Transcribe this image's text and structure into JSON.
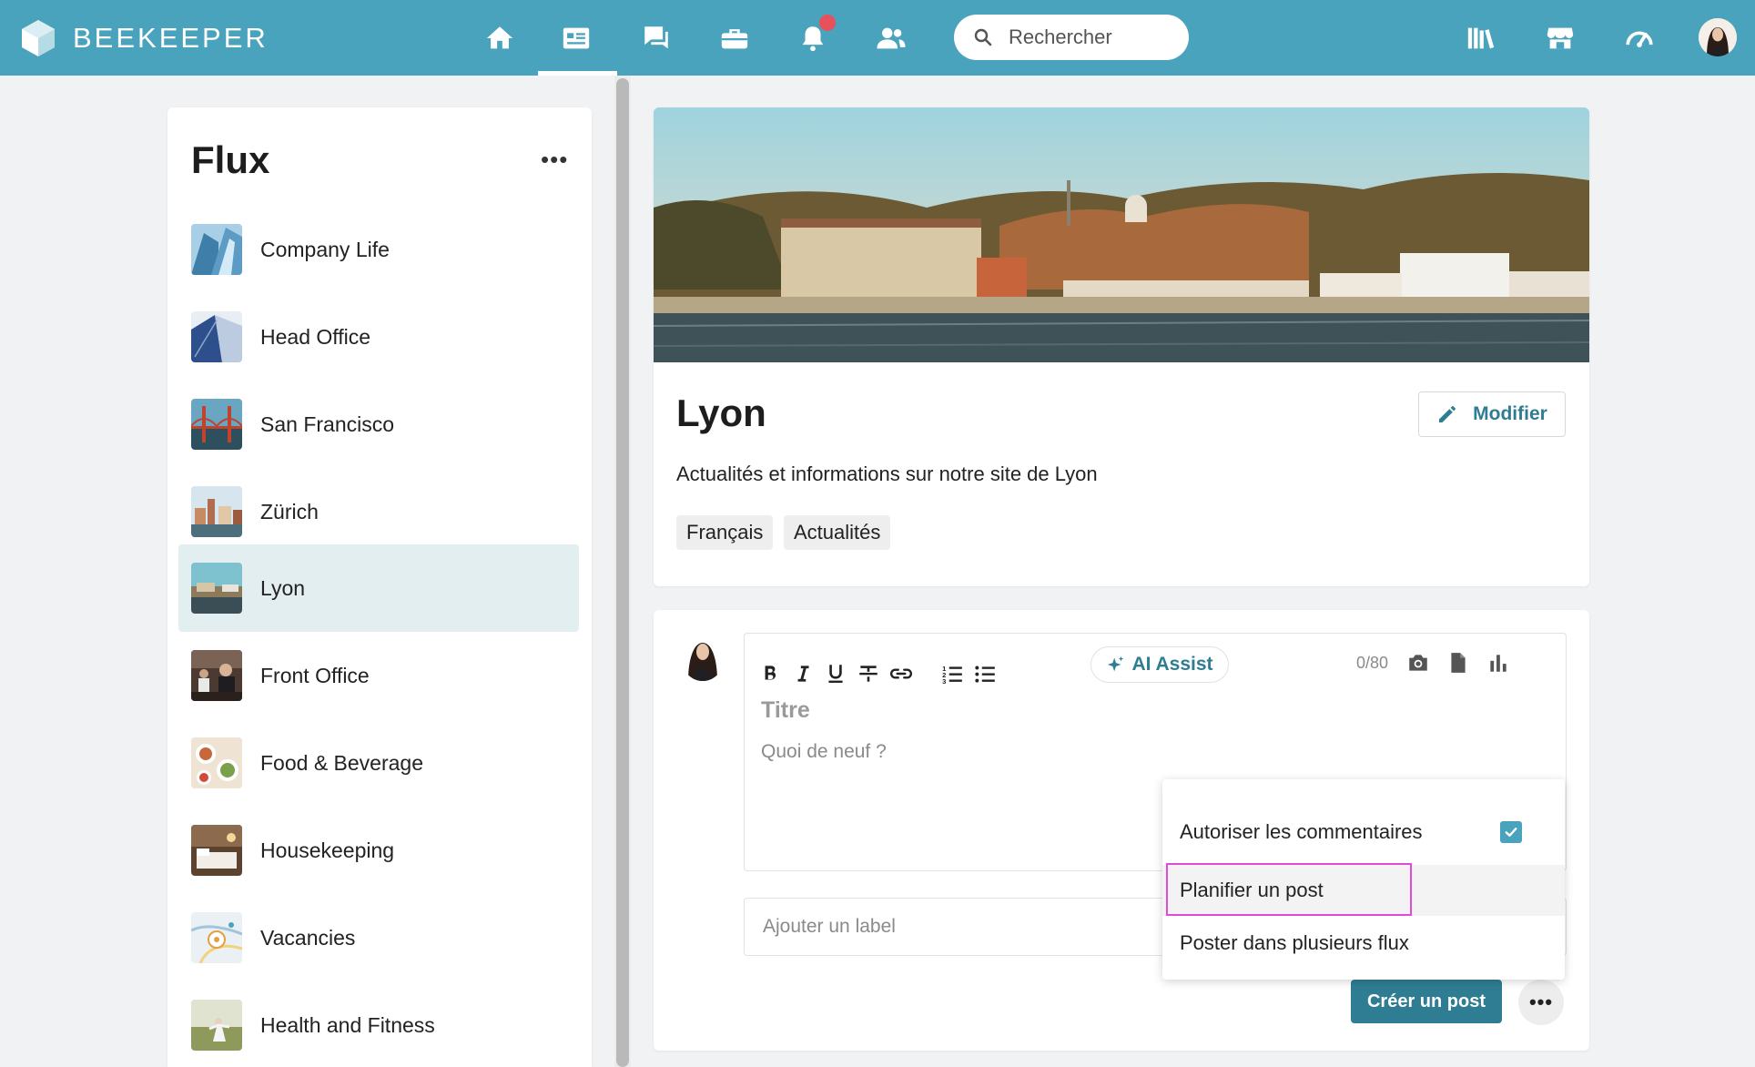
{
  "app": {
    "brand": "BEEKEEPER",
    "search_placeholder": "Rechercher"
  },
  "nav": {
    "icons": [
      "home-icon",
      "feed-icon",
      "chat-icon",
      "toolbox-icon",
      "bell-icon",
      "people-icon"
    ],
    "active": "feed-icon",
    "right_icons": [
      "library-icon",
      "shop-icon",
      "dashboard-icon"
    ]
  },
  "sidebar": {
    "title": "Flux",
    "more": "•••",
    "items": [
      {
        "label": "Company Life"
      },
      {
        "label": "Head Office"
      },
      {
        "label": "San Francisco"
      },
      {
        "label": "Zürich"
      },
      {
        "label": "Lyon",
        "active": true
      },
      {
        "label": "Front Office"
      },
      {
        "label": "Food & Beverage"
      },
      {
        "label": "Housekeeping"
      },
      {
        "label": "Vacancies"
      },
      {
        "label": "Health and Fitness"
      }
    ]
  },
  "stream": {
    "name": "Lyon",
    "edit_label": "Modifier",
    "description": "Actualités et informations sur notre site de Lyon",
    "tags": [
      "Français",
      "Actualités"
    ]
  },
  "composer": {
    "toolbar": [
      "bold-icon",
      "italic-icon",
      "underline-icon",
      "strikethrough-icon",
      "link-icon",
      "numbered-list-icon",
      "bullet-list-icon"
    ],
    "ai_assist_label": "AI Assist",
    "counter": "0/80",
    "title_placeholder": "Titre",
    "body_placeholder": "Quoi de neuf ?",
    "label_placeholder": "Ajouter un label",
    "create_label": "Créer un post",
    "more": "•••"
  },
  "menu": {
    "items": [
      {
        "label": "Autoriser les commentaires",
        "checked": true
      },
      {
        "label": "Planifier un post"
      },
      {
        "label": "Poster dans plusieurs flux"
      }
    ]
  },
  "colors": {
    "topbar": "#4aa3bd",
    "accent": "#2f7d92",
    "active_item": "#e3eef0",
    "notification": "#e8505b",
    "highlight": "#e04ad6"
  }
}
